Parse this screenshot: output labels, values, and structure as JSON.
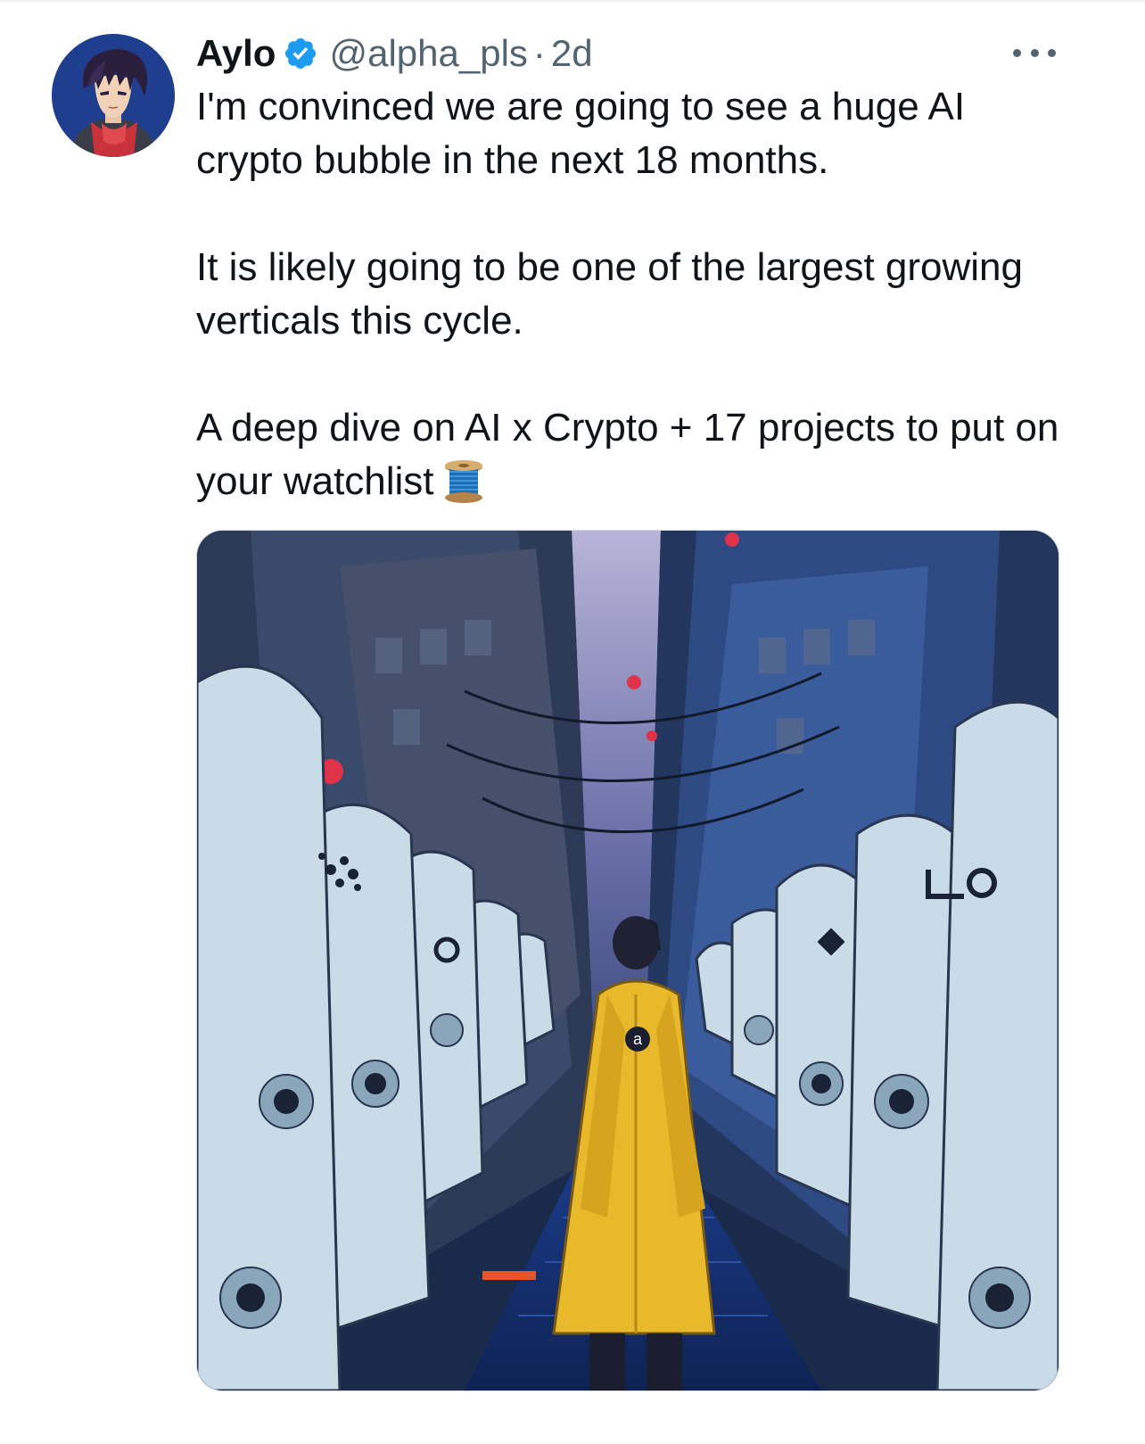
{
  "tweet": {
    "author": {
      "display_name": "Aylo",
      "handle": "@alpha_pls",
      "verified": true,
      "avatar_icon": "anime-avatar"
    },
    "separator": "·",
    "timestamp": "2d",
    "more_icon": "more-horizontal-icon",
    "paragraphs": [
      "I'm convinced we are going to see a huge AI crypto bubble in the next 18 months.",
      "It is likely going to be one of the largest growing verticals this cycle.",
      "A deep dive on AI x Crypto + 17 projects to put on your watchlist"
    ],
    "emoji": "thread-spool-emoji",
    "media": {
      "type": "illustration",
      "subject": "person in yellow coat walking through alley lined with white robots",
      "coat_badge": "a"
    }
  },
  "colors": {
    "text_primary": "#0f1419",
    "text_secondary": "#536471",
    "verified_blue": "#1d9bf0",
    "coat_yellow": "#e8b92a",
    "robot_white": "#c9dbe6",
    "alley_blue": "#1f3f7a"
  }
}
